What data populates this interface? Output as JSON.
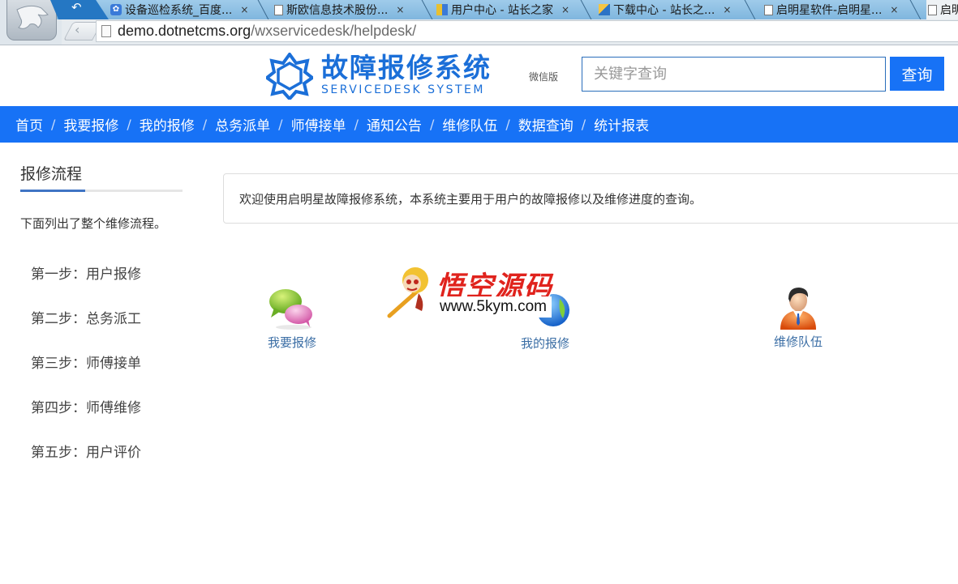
{
  "browser": {
    "tabs": [
      {
        "title": "设备巡检系统_百度...",
        "icon": "paw-icon"
      },
      {
        "title": "斯欧信息技术股份...",
        "icon": "page-icon"
      },
      {
        "title": "用户中心 - 站长之家",
        "icon": "site-icon"
      },
      {
        "title": "下载中心 - 站长之...",
        "icon": "download-site-icon"
      },
      {
        "title": "启明星软件-启明星...",
        "icon": "page-icon"
      },
      {
        "title": "启明",
        "icon": "page-icon"
      }
    ],
    "close_glyph": "×",
    "back_glyph": "↶",
    "nav_back_glyph": "‹",
    "url_host": "demo.dotnetcms.org",
    "url_path": "/wxservicedesk/helpdesk/"
  },
  "header": {
    "brand_cn": "故障报修系统",
    "brand_en": "SERVICEDESK SYSTEM",
    "wechat_link": "微信版",
    "search_placeholder": "关键字查询",
    "search_value": "",
    "search_button": "查询",
    "accent_color": "#1772f6"
  },
  "nav": {
    "separator": "/",
    "items": [
      {
        "label": "首页"
      },
      {
        "label": "我要报修"
      },
      {
        "label": "我的报修"
      },
      {
        "label": "总务派单"
      },
      {
        "label": "师傅接单"
      },
      {
        "label": "通知公告"
      },
      {
        "label": "维修队伍"
      },
      {
        "label": "数据查询"
      },
      {
        "label": "统计报表"
      }
    ]
  },
  "sidebar": {
    "title": "报修流程",
    "description": "下面列出了整个维修流程。",
    "steps": [
      "第一步：用户报修",
      "第二步：总务派工",
      "第三步：师傅接单",
      "第四步：师傅维修",
      "第五步：用户评价"
    ]
  },
  "main": {
    "welcome": "欢迎使用启明星故障报修系统，本系统主要用于用户的故障报修以及维修进度的查询。",
    "shortcuts": [
      {
        "label": "我要报修",
        "icon": "chat-bubbles-icon"
      },
      {
        "label": "我的报修",
        "icon": "globe-icon"
      },
      {
        "label": "维修队伍",
        "icon": "person-icon"
      }
    ]
  },
  "watermark": {
    "title": "悟空源码",
    "url": "www.5kym.com"
  }
}
